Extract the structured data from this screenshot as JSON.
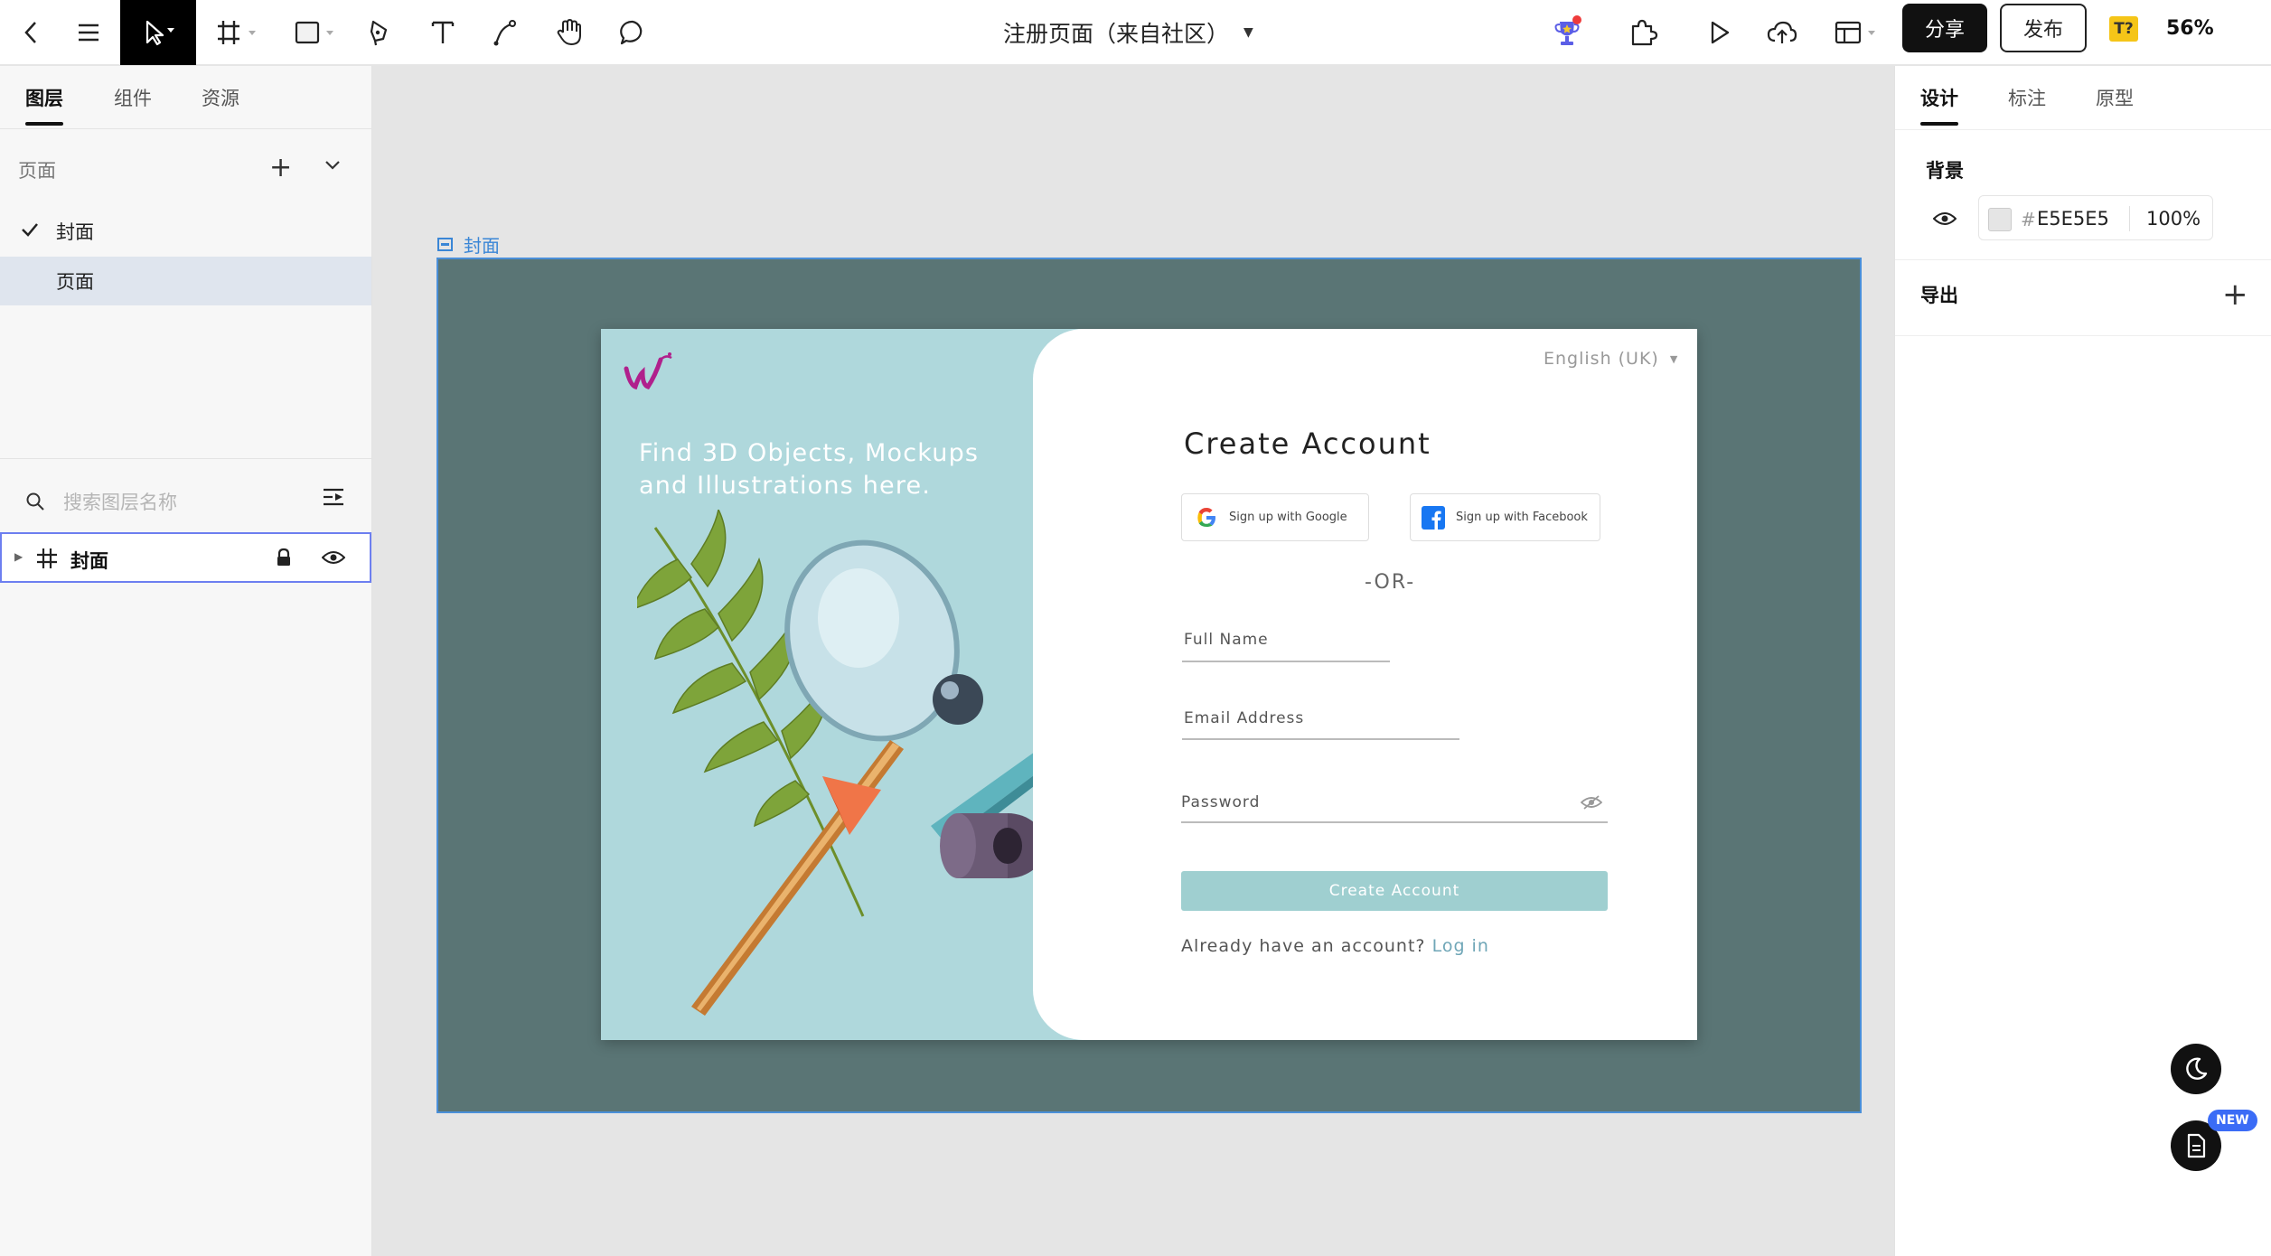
{
  "toolbar": {
    "title": "注册页面（来自社区）",
    "share_label": "分享",
    "publish_label": "发布",
    "text_badge": "T?",
    "zoom": "56%",
    "icons": [
      "back-icon",
      "menu-icon",
      "move-tool-icon",
      "frame-tool-icon",
      "rectangle-tool-icon",
      "pen-tool-icon",
      "text-tool-icon",
      "path-tool-icon",
      "hand-tool-icon",
      "comment-icon",
      "trophy-icon",
      "plugin-icon",
      "play-icon",
      "upload-cloud-icon",
      "layout-icon"
    ]
  },
  "left_panel": {
    "tabs": [
      "图层",
      "组件",
      "资源"
    ],
    "active_tab": "图层",
    "pages_header": "页面",
    "pages": [
      {
        "label": "封面",
        "checked": true
      },
      {
        "label": "页面",
        "checked": false
      }
    ],
    "search_placeholder": "搜索图层名称",
    "layers": [
      {
        "name": "封面",
        "locked": true,
        "visible": true
      }
    ]
  },
  "right_panel": {
    "tabs": [
      "设计",
      "标注",
      "原型"
    ],
    "active_tab": "设计",
    "background_title": "背景",
    "bg_hash": "#",
    "bg_hex": "E5E5E5",
    "bg_opacity": "100",
    "bg_opacity_unit": "%",
    "export_title": "导出"
  },
  "floating": {
    "new_badge": "NEW",
    "icons": [
      "moon-icon",
      "document-icon"
    ]
  },
  "canvas": {
    "frame_label": "封面",
    "frame_color": "#5a7575",
    "design": {
      "tagline_line1": "Find  3D Objects, Mockups",
      "tagline_line2": "and Illustrations here.",
      "language": "English (UK)",
      "title": "Create Account",
      "google_button": "Sign up with Google",
      "facebook_button": "Sign up with Facebook",
      "or_text": "-OR-",
      "full_name_label": "Full Name",
      "email_label": "Email Address",
      "password_label": "Password",
      "submit_label": "Create Account",
      "login_prompt": "Already have an account?",
      "login_link": "Log in",
      "accent_color": "#afd8dc",
      "brand_color": "#b0208c"
    }
  }
}
